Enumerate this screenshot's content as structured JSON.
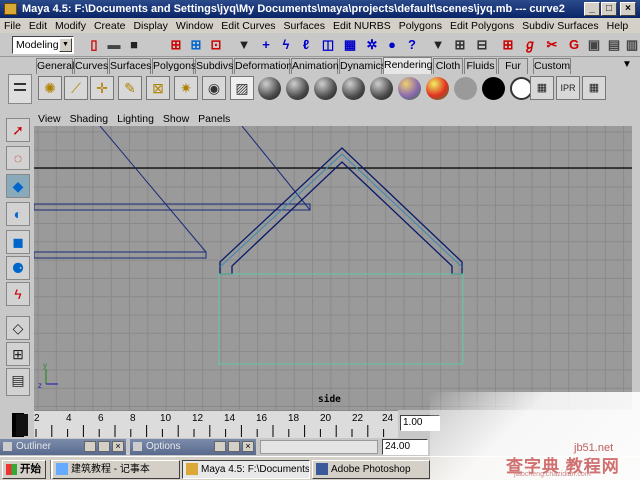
{
  "window": {
    "title": "Maya 4.5: F:\\Documents and Settings\\jyq\\My Documents\\maya\\projects\\default\\scenes\\jyq.mb  ---  curve2",
    "minimize": "_",
    "maximize": "□",
    "close": "×"
  },
  "menubar": [
    "File",
    "Edit",
    "Modify",
    "Create",
    "Display",
    "Window",
    "Edit Curves",
    "Surfaces",
    "Edit NURBS",
    "Polygons",
    "Edit Polygons",
    "Subdiv Surfaces",
    "Help"
  ],
  "statusline": {
    "mode": "Modeling"
  },
  "shelf": {
    "tabs": [
      "General",
      "Curves",
      "Surfaces",
      "Polygons",
      "Subdivs",
      "Deformation",
      "Animation",
      "Dynamics",
      "Rendering",
      "Cloth",
      "Fluids",
      "Fur",
      "Custom"
    ],
    "active_tab": "Rendering",
    "icons": [
      "ambient-light-icon",
      "directional-light-icon",
      "point-light-icon",
      "spot-light-icon",
      "area-light-icon",
      "volume-light-icon",
      "camera-icon",
      "hypershade-icon"
    ],
    "material_colors": [
      "#555555",
      "#555555",
      "#555555",
      "#555555",
      "#555555",
      "#8a6ab0",
      "#e03020",
      "#9a9a9a",
      "#000000",
      "#ffffff"
    ]
  },
  "panel": {
    "menus": [
      "View",
      "Shading",
      "Lighting",
      "Show",
      "Panels"
    ],
    "view_name": "side"
  },
  "timeline": {
    "ticks": [
      "2",
      "4",
      "6",
      "8",
      "10",
      "12",
      "14",
      "16",
      "18",
      "20",
      "22",
      "24"
    ],
    "current_frame": "1.00",
    "end_frame": "24.00"
  },
  "floating_windows": [
    {
      "title": "Outliner"
    },
    {
      "title": "Options"
    }
  ],
  "taskbar": {
    "start": "开始",
    "tasks": [
      "建筑教程 - 记事本",
      "Maya 4.5: F:\\Documents...",
      "Adobe Photoshop"
    ]
  },
  "watermark": {
    "domain": "jb51.net",
    "text": "查字典 教程网",
    "url": "jiaocheng.chazidian.com"
  }
}
